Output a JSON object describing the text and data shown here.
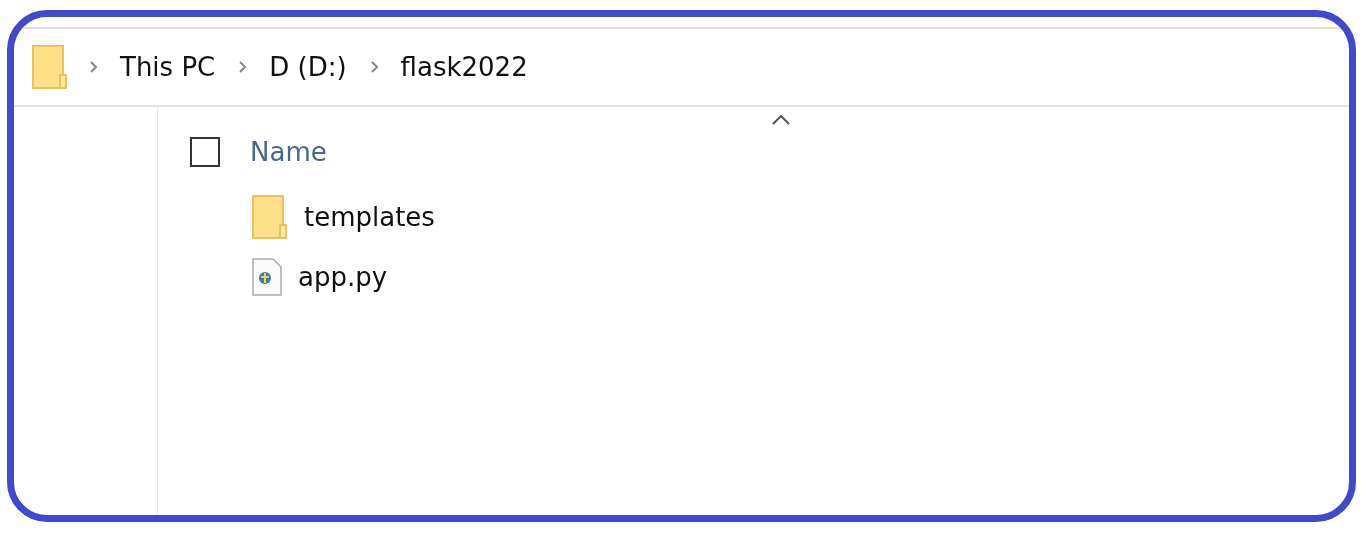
{
  "breadcrumb": [
    {
      "label": "This PC"
    },
    {
      "label": "D (D:)"
    },
    {
      "label": "flask2022"
    }
  ],
  "list_header": {
    "checked": false,
    "column": "Name",
    "sort_ascending": true
  },
  "items": [
    {
      "kind": "folder",
      "name": "templates"
    },
    {
      "kind": "python-file",
      "name": "app.py"
    }
  ]
}
